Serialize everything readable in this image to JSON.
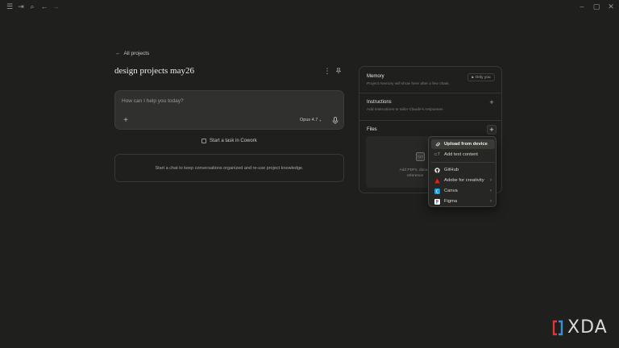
{
  "titlebar": {
    "left_icons": [
      "menu-icon",
      "sidebar-toggle-icon",
      "search-icon",
      "back-arrow-icon",
      "forward-arrow-icon"
    ],
    "window_controls": [
      "minimize-icon",
      "maximize-icon",
      "close-icon"
    ]
  },
  "project": {
    "back_label": "All projects",
    "title": "design projects may26"
  },
  "composer": {
    "placeholder": "How can I help you today?",
    "model": "Opus 4.7"
  },
  "cowork": {
    "label": "Start a task in Cowork"
  },
  "chats": {
    "empty_text": "Start a chat to keep conversations organized and re-use project knowledge."
  },
  "panel": {
    "memory": {
      "title": "Memory",
      "subtitle": "Project memory will show here after a few chats.",
      "visibility": "Only you"
    },
    "instructions": {
      "title": "Instructions",
      "subtitle": "Add instructions to tailor Claude's responses"
    },
    "files": {
      "title": "Files",
      "drop_text_1": "Add PDFs, docum",
      "drop_text_2": "reference"
    }
  },
  "menu": {
    "items": [
      {
        "label": "Upload from device",
        "icon": "paperclip-icon",
        "active": true
      },
      {
        "label": "Add text content",
        "icon": "text-icon"
      },
      {
        "label": "GitHub",
        "icon": "github-icon"
      },
      {
        "label": "Adobe for creativity",
        "icon": "adobe-icon",
        "submenu": true
      },
      {
        "label": "Canva",
        "icon": "canva-icon",
        "submenu": true
      },
      {
        "label": "Figma",
        "icon": "figma-icon",
        "submenu": true
      }
    ]
  },
  "watermark": {
    "text": "XDA"
  },
  "colors": {
    "background": "#1f1f1e",
    "surface": "#30302e",
    "adobe": "#e0201b",
    "canva": "#18a0e0",
    "xda_red": "#e3343b",
    "xda_blue": "#3a8fd6"
  }
}
